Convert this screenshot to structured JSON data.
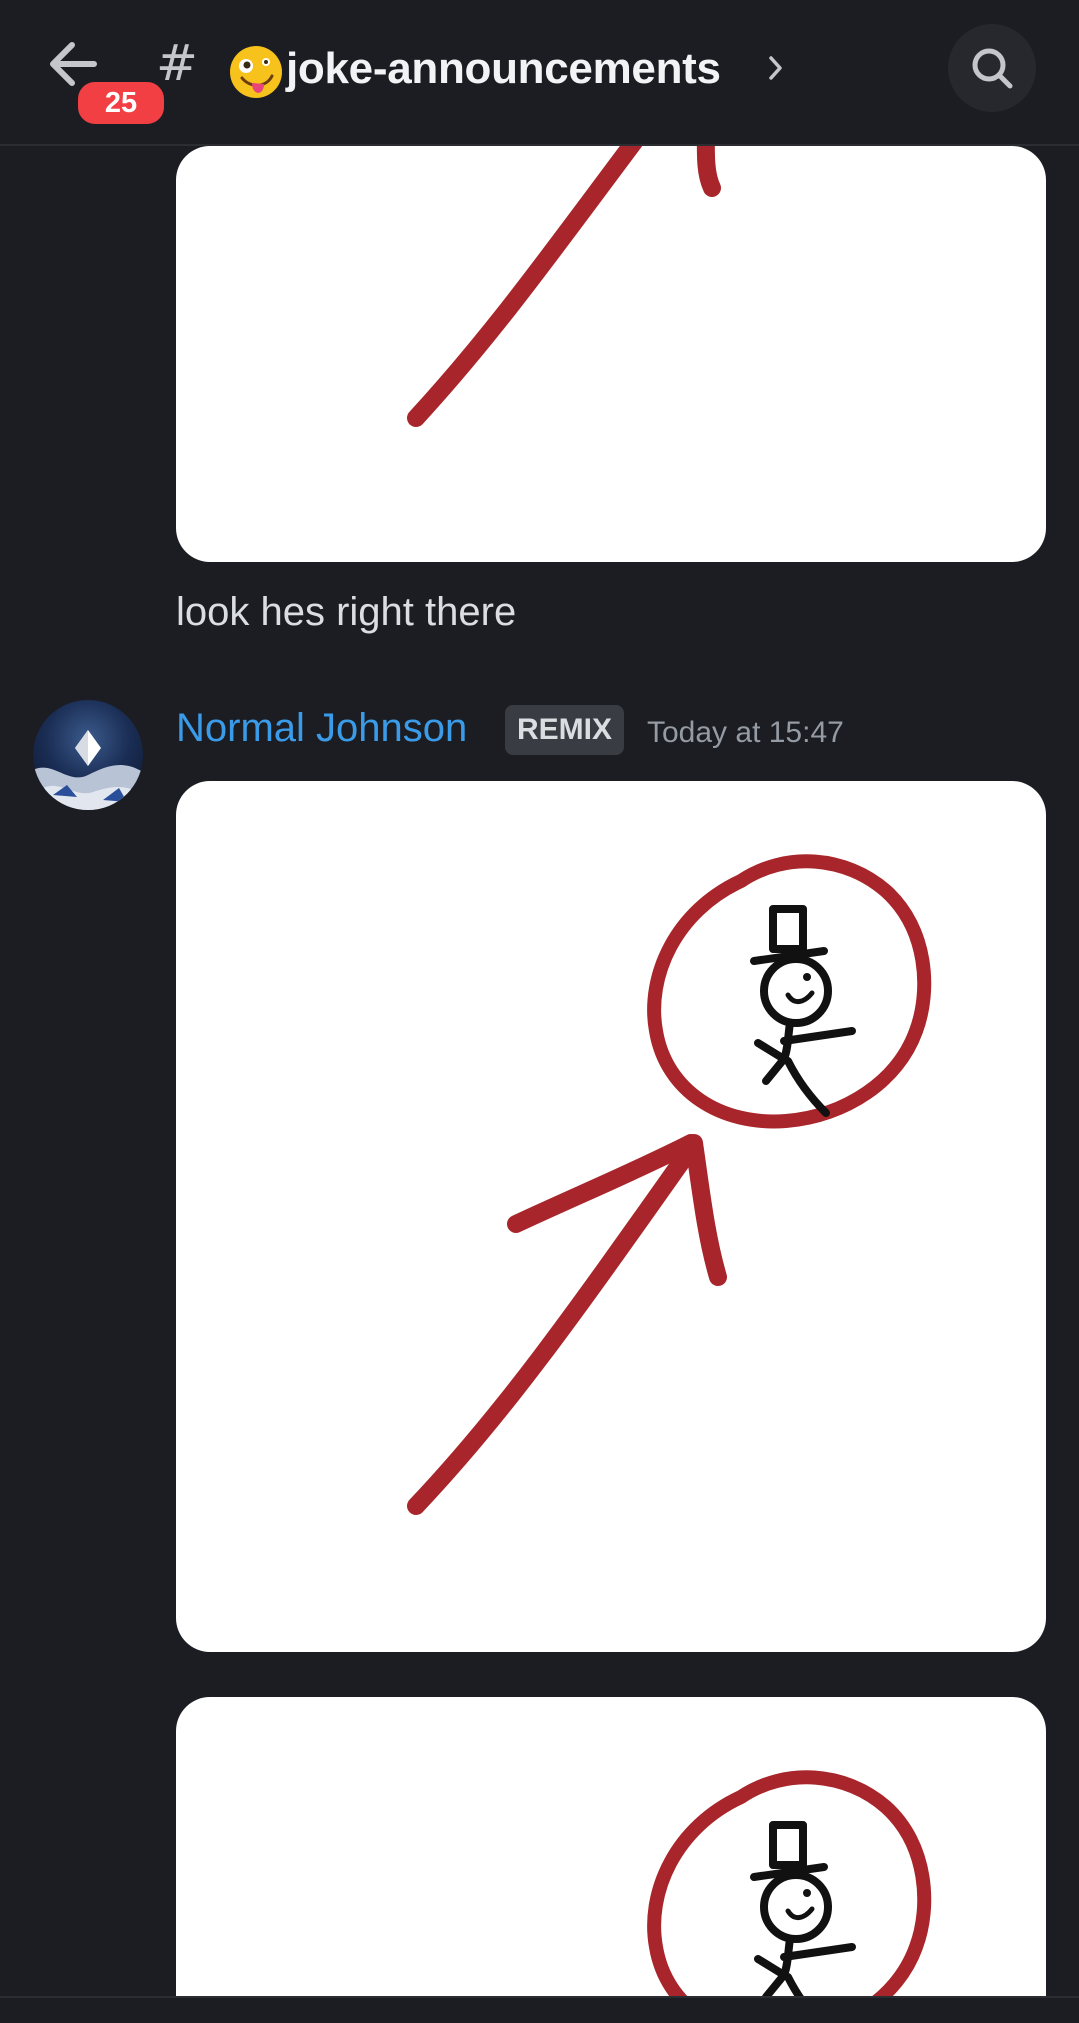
{
  "header": {
    "unread_count": "25",
    "channel_prefix": "#",
    "channel_emoji": "zany-face",
    "channel_name": "joke-announcements",
    "search_icon": "search-icon",
    "back_icon": "arrow-left-icon",
    "chevron_icon": "chevron-right-icon"
  },
  "messages": [
    {
      "text": "look hes right there"
    },
    {
      "author": "Normal Johnson",
      "role_tag": "REMIX",
      "timestamp": "Today at 15:47",
      "author_color": "#3a9be8"
    }
  ],
  "colors": {
    "background": "#1c1d22",
    "badge": "#f23f43",
    "drawing_red": "#a8262b"
  }
}
